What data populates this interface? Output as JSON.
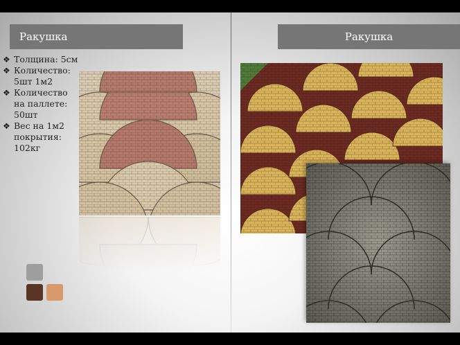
{
  "left_panel": {
    "title": "Ракушка",
    "specs": [
      "Толщина: 5см",
      "Количество: 5шт 1м2",
      "Количество на паллете: 50шт",
      "Вес на 1м2 покрытия: 102кг"
    ],
    "bullet_icon": "diamond-bullet-icon",
    "swatches": [
      "#9e9e9e",
      "#5a3424",
      "#d79a6c"
    ]
  },
  "right_panel": {
    "title": "Ракушка"
  },
  "colors": {
    "title_bar": "#767676",
    "title_text": "#ffffff"
  }
}
